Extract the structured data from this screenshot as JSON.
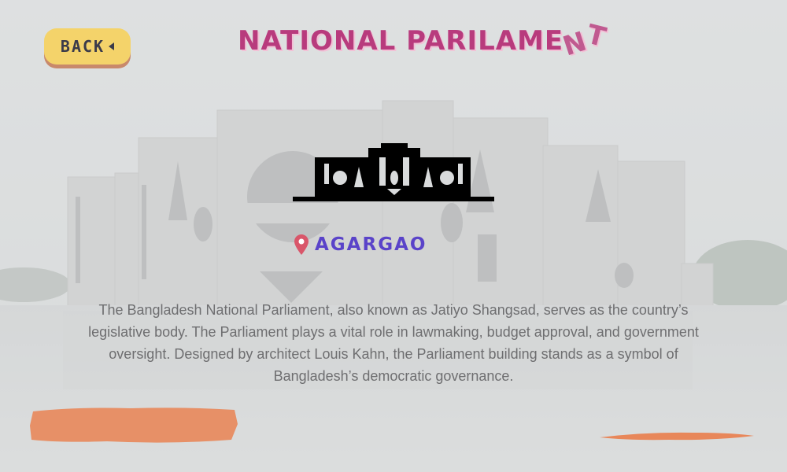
{
  "header": {
    "back_label": "BACK",
    "title_main": "NATIONAL PARILAME",
    "title_tail": [
      "N",
      "T"
    ]
  },
  "location": {
    "name": "AGARGAO",
    "icon": "map-pin-icon"
  },
  "description": "The Bangladesh National Parliament, also known as Jatiyo Shangsad, serves as the country’s legislative body. The Parliament plays a vital role in lawmaking, budget approval, and government oversight. Designed by architect Louis Kahn, the Parliament building stands as a symbol of Bangladesh’s democratic governance.",
  "colors": {
    "back_button": "#f4d36a",
    "title": "#b83b7d",
    "location": "#5a43c9",
    "pin": "#d9566a",
    "brush": "#e8875a"
  }
}
